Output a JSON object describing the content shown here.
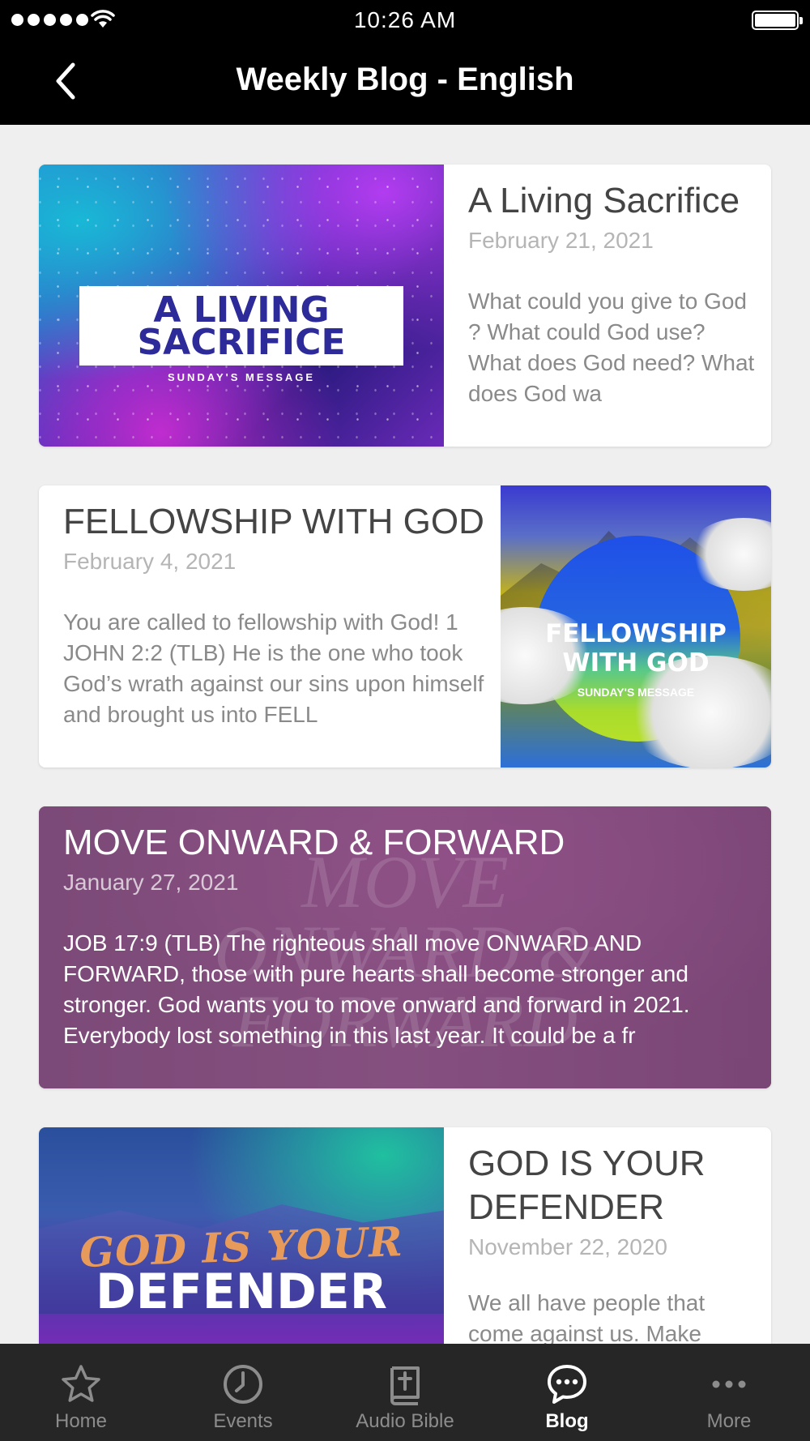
{
  "status_bar": {
    "time": "10:26 AM"
  },
  "nav": {
    "title": "Weekly Blog - English",
    "back_icon": "chevron-left-icon"
  },
  "posts": [
    {
      "title": "A Living Sacrifice",
      "date": "February 21, 2021",
      "excerpt": "What could you give to God ? What could God use? What does God need? What does God wa",
      "thumbnail": {
        "line1": "A LIVING",
        "line2": "SACRIFICE",
        "sub": "SUNDAY'S MESSAGE"
      }
    },
    {
      "title": "FELLOWSHIP WITH GOD",
      "date": "February 4, 2021",
      "excerpt": "You are called to fellowship with God! 1 JOHN 2:2 (TLB) He is the one who took God’s wrath against our sins upon himself and brought us into FELL",
      "thumbnail": {
        "line1": "FELLOWSHIP",
        "line2": "WITH GOD",
        "sub": "SUNDAY'S MESSAGE"
      }
    },
    {
      "title": "MOVE ONWARD & FORWARD",
      "date": "January 27, 2021",
      "excerpt": "JOB 17:9 (TLB) The righteous shall move ONWARD AND FORWARD, those with pure hearts shall become stronger and stronger. God wants you to move onward and forward in 2021. Everybody lost something in this last year. It could be a fr",
      "background": {
        "line1": "MOVE",
        "line2": "ONWARD &",
        "line3": "FORWARD"
      }
    },
    {
      "title": "GOD IS YOUR DEFENDER",
      "date": "November 22, 2020",
      "excerpt": "We all have people that come against us. Make",
      "thumbnail": {
        "line1": "GOD IS YOUR",
        "line2": "DEFENDER"
      }
    }
  ],
  "tabs": [
    {
      "label": "Home",
      "icon": "star-icon",
      "active": false
    },
    {
      "label": "Events",
      "icon": "clock-icon",
      "active": false
    },
    {
      "label": "Audio Bible",
      "icon": "bible-icon",
      "active": false
    },
    {
      "label": "Blog",
      "icon": "chat-bubble-icon",
      "active": true
    },
    {
      "label": "More",
      "icon": "more-dots-icon",
      "active": false
    }
  ],
  "colors": {
    "tab_bar_bg": "#262626",
    "nav_bg": "#000000",
    "feed_bg": "#efefef",
    "active_tab": "#ffffff",
    "inactive_tab": "#8c8c8c"
  }
}
